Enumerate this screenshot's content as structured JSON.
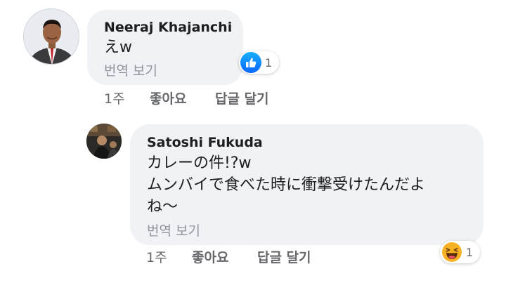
{
  "comments": [
    {
      "author": "Neeraj Khajanchi",
      "text_lines": [
        "えw"
      ],
      "translate_label": "번역 보기",
      "reaction": {
        "icon": "like-icon",
        "count": "1"
      },
      "time": "1주",
      "like_label": "좋아요",
      "reply_label": "답글 달기"
    },
    {
      "author": "Satoshi Fukuda",
      "text_lines": [
        "カレーの件!?w",
        "ムンバイで食べた時に衝撃受けたんだよ",
        "ね〜"
      ],
      "translate_label": "번역 보기",
      "reaction": {
        "icon": "haha-icon",
        "count": "1"
      },
      "time": "1주",
      "like_label": "좋아요",
      "reply_label": "답글 달기"
    }
  ],
  "colors": {
    "bubble": "#f0f2f5",
    "author": "#1c1e21",
    "muted": "#65676b",
    "like_blue": "#0866ff",
    "haha_yellow": "#f7b125"
  }
}
